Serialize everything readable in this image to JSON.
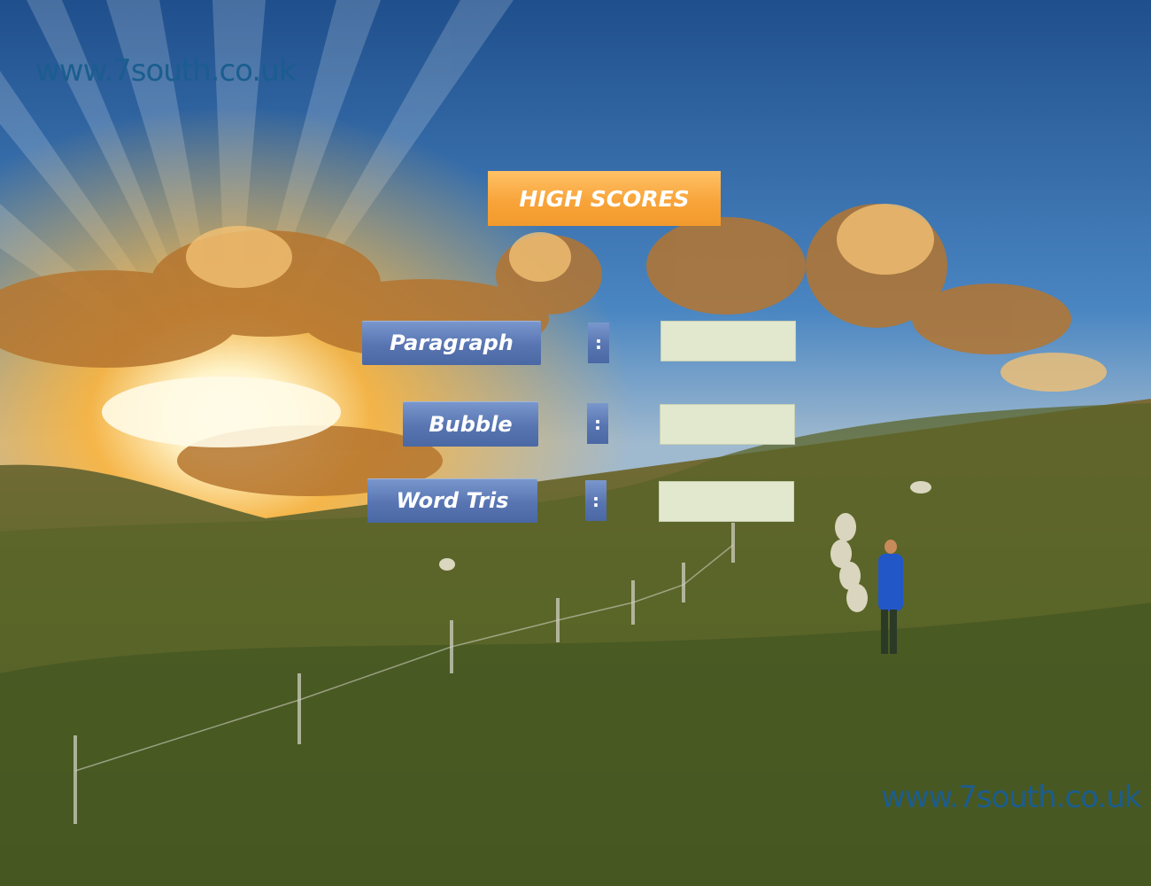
{
  "watermark": {
    "top": "www.7south.co.uk",
    "bottom": "www.7south.co.uk"
  },
  "title": "HIGH SCORES",
  "games": [
    {
      "label": "Paragraph",
      "separator": ":",
      "score": ""
    },
    {
      "label": "Bubble",
      "separator": ":",
      "score": ""
    },
    {
      "label": "Word Tris",
      "separator": ":",
      "score": ""
    }
  ],
  "colors": {
    "title_button": "#f8a43a",
    "game_button": "#5875b2",
    "score_box": "#e1e8cd",
    "watermark": "#1b5d8f"
  }
}
